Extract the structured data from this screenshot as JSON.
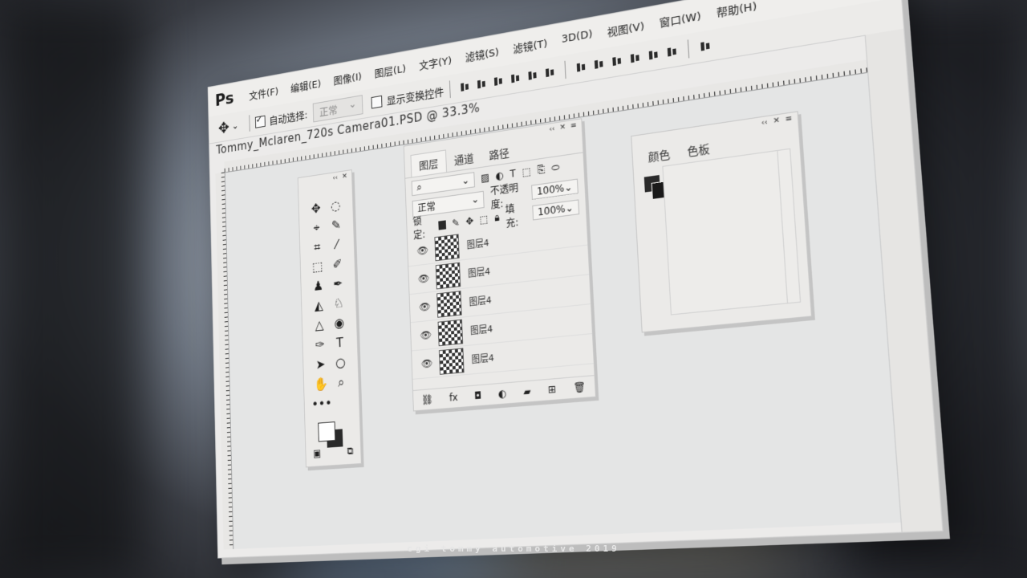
{
  "app": {
    "logo": "Ps",
    "menu": [
      "文件(F)",
      "编辑(E)",
      "图像(I)",
      "图层(L)",
      "文字(Y)",
      "滤镜(S)",
      "滤镜(T)",
      "3D(D)",
      "视图(V)",
      "窗口(W)",
      "帮助(H)"
    ],
    "window_controls": [
      "–",
      "▢",
      "✕"
    ]
  },
  "options": {
    "auto_select_label": "自动选择:",
    "auto_select_checked": true,
    "auto_select_mode": "正常",
    "show_transform_label": "显示变换控件"
  },
  "document": {
    "tab_title": "Tommy_Mclaren_720s Camera01.PSD @ 33.3%"
  },
  "layers_panel": {
    "tabs": [
      "图层",
      "通道",
      "路径"
    ],
    "active_tab": 0,
    "blend_mode": "正常",
    "opacity_label": "不透明度:",
    "opacity_value": "100%",
    "fill_label": "填充:",
    "fill_value": "100%",
    "lock_label": "锁定:",
    "layers": [
      {
        "name": "图层4"
      },
      {
        "name": "图层4"
      },
      {
        "name": "图层4"
      },
      {
        "name": "图层4"
      },
      {
        "name": "图层4"
      }
    ],
    "footer_icons": [
      "link-icon",
      "fx-icon",
      "mask-icon",
      "adjustment-icon",
      "group-icon",
      "new-layer-icon",
      "trash-icon"
    ],
    "footer_fx": "fx"
  },
  "color_panel": {
    "tabs": [
      "颜色",
      "色板"
    ]
  },
  "toolbox": {
    "tools": [
      "✥",
      "◌",
      "⌖",
      "✎",
      "⌗",
      "⁄",
      "⬚",
      "✐",
      "♟",
      "✒",
      "◭",
      "♘",
      "△",
      "◉",
      "✑",
      "T",
      "➤",
      "○",
      "✋",
      "⌕"
    ],
    "more": "•••"
  },
  "watermark": "cgi tommy automotive 2019"
}
